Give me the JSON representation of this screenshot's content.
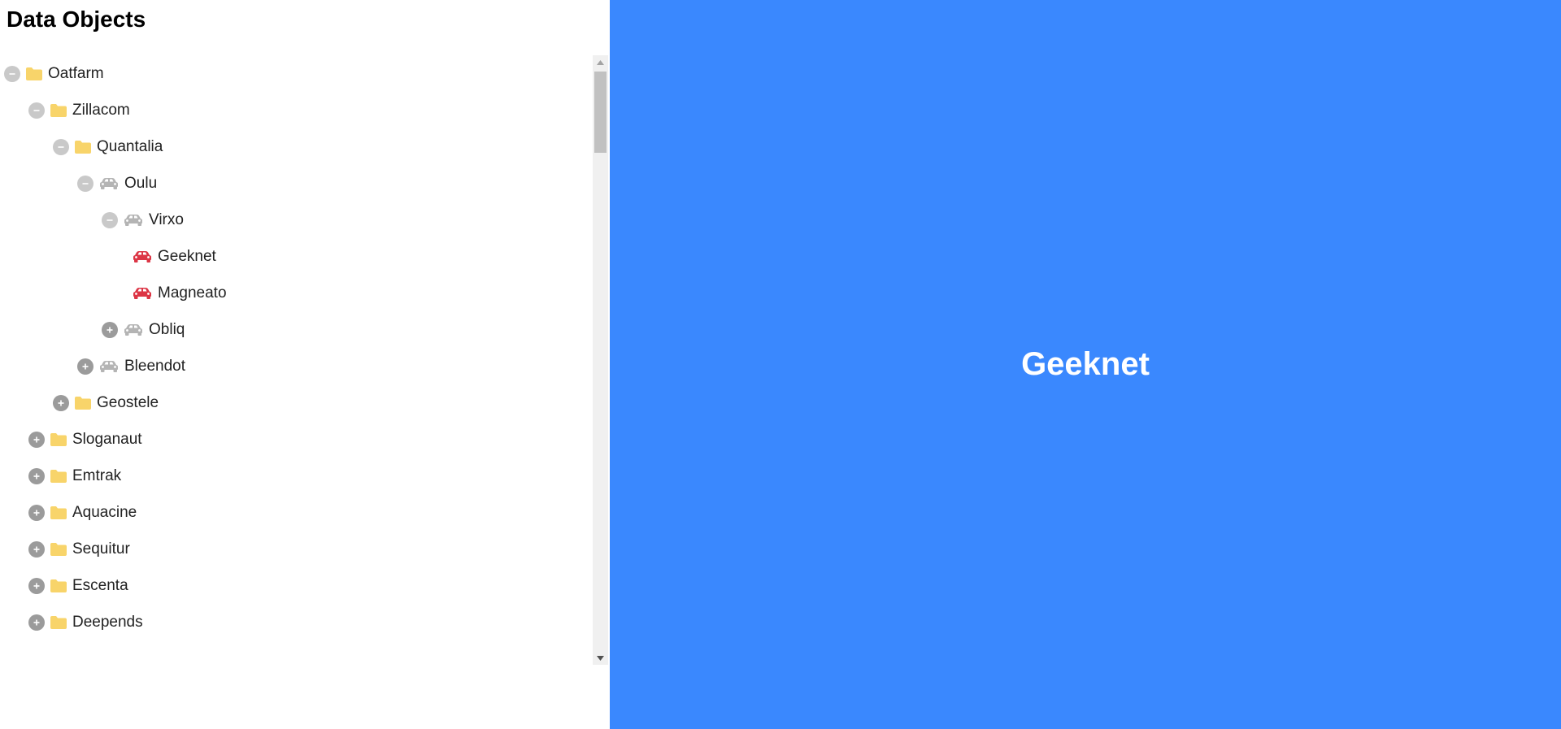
{
  "header": {
    "title": "Data Objects"
  },
  "colors": {
    "folder": "#f8d46a",
    "car_branch": "#b4b4b4",
    "car_leaf": "#dc3545",
    "toggle_expanded": "#c9c9c9",
    "toggle_collapsed": "#9b9b9b",
    "detail_background": "#3a88fe",
    "detail_text": "#ffffff"
  },
  "tree": {
    "nodes": [
      {
        "label": "Oatfarm",
        "level": 0,
        "icon": "folder-icon",
        "toggle": "collapse"
      },
      {
        "label": "Zillacom",
        "level": 1,
        "icon": "folder-icon",
        "toggle": "collapse"
      },
      {
        "label": "Quantalia",
        "level": 2,
        "icon": "folder-icon",
        "toggle": "collapse"
      },
      {
        "label": "Oulu",
        "level": 3,
        "icon": "car-icon",
        "toggle": "collapse"
      },
      {
        "label": "Virxo",
        "level": 4,
        "icon": "car-icon",
        "toggle": "collapse"
      },
      {
        "label": "Geeknet",
        "level": 5,
        "icon": "car-leaf-icon",
        "toggle": "none"
      },
      {
        "label": "Magneato",
        "level": 5,
        "icon": "car-leaf-icon",
        "toggle": "none"
      },
      {
        "label": "Obliq",
        "level": 4,
        "icon": "car-icon",
        "toggle": "expand"
      },
      {
        "label": "Bleendot",
        "level": 3,
        "icon": "car-icon",
        "toggle": "expand"
      },
      {
        "label": "Geostele",
        "level": 2,
        "icon": "folder-icon",
        "toggle": "expand"
      },
      {
        "label": "Sloganaut",
        "level": 1,
        "icon": "folder-icon",
        "toggle": "expand"
      },
      {
        "label": "Emtrak",
        "level": 1,
        "icon": "folder-icon",
        "toggle": "expand"
      },
      {
        "label": "Aquacine",
        "level": 1,
        "icon": "folder-icon",
        "toggle": "expand"
      },
      {
        "label": "Sequitur",
        "level": 1,
        "icon": "folder-icon",
        "toggle": "expand"
      },
      {
        "label": "Escenta",
        "level": 1,
        "icon": "folder-icon",
        "toggle": "expand"
      },
      {
        "label": "Deepends",
        "level": 1,
        "icon": "folder-icon",
        "toggle": "expand"
      }
    ]
  },
  "detail": {
    "title": "Geeknet"
  }
}
